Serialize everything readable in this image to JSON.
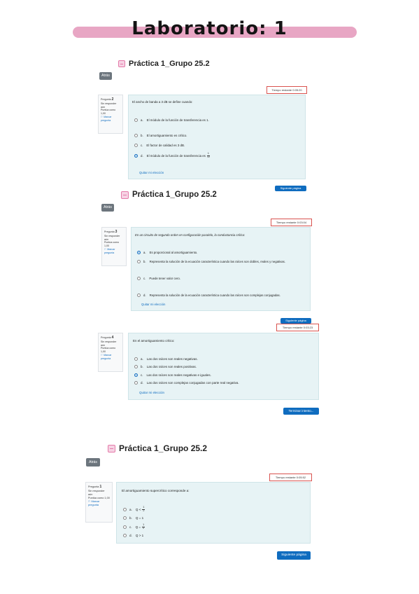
{
  "page": {
    "title": "Laboratorio: 1"
  },
  "sections": [
    {
      "title": "Práctica 1_Grupo 25.2",
      "back_label": "Atrás",
      "timer": "Tiempo restante 0:05:20",
      "info": {
        "label": "Pregunta",
        "number": "2",
        "status": "Sin responder aún",
        "score": "Puntúa como 1,00",
        "flag": "Marcar pregunta"
      },
      "question": "El ancho de banda a 3 dB se define cuando:",
      "options": [
        {
          "letter": "a.",
          "text": "El módulo de la función de transferencia es 1.",
          "selected": false
        },
        {
          "letter": "b.",
          "text": "El amortiguamiento es crítico.",
          "selected": false
        },
        {
          "letter": "c.",
          "text": "El factor de calidad es 3 dB.",
          "selected": false
        },
        {
          "letter": "d.",
          "text": "El módulo de la función de transferencia es",
          "frac_num": "1",
          "frac_den": "√2",
          "selected": true
        }
      ],
      "clear_label": "Quitar mi elección",
      "next_label": "Siguiente página"
    },
    {
      "title": "Práctica 1_Grupo 25.2",
      "back_label": "Atrás",
      "timer": "Tiempo restante 0:03:04",
      "info": {
        "label": "Pregunta",
        "number": "3",
        "status": "Sin responder aún",
        "score": "Puntúa como 1,00",
        "flag": "Marcar pregunta"
      },
      "question": "En un circuito de segundo orden en configuración paralelo, la conductancia crítica:",
      "options": [
        {
          "letter": "a.",
          "text": "Es proporcional al amortiguamiento.",
          "selected": true
        },
        {
          "letter": "b.",
          "text": "Representa la solución de la ecuación característica cuando las raíces son dobles, reales y negativas.",
          "selected": false
        },
        {
          "letter": "c.",
          "text": "Puede tener valor cero.",
          "selected": false
        },
        {
          "letter": "d.",
          "text": "Representa la solución de la ecuación característica cuando las raíces son complejas conjugadas.",
          "selected": false
        }
      ],
      "clear_label": "Quitar mi elección",
      "next_label": "Siguiente página"
    },
    {
      "timer": "Tiempo restante 0:03:23",
      "info": {
        "label": "Pregunta",
        "number": "4",
        "status": "Sin responder aún",
        "score": "Puntúa como 1,00",
        "flag": "Marcar pregunta"
      },
      "question": "En el amortiguamiento crítico:",
      "options": [
        {
          "letter": "a.",
          "text": "Las dos raíces son reales negativas.",
          "selected": false
        },
        {
          "letter": "b.",
          "text": "Las dos raíces son reales positivas.",
          "selected": false
        },
        {
          "letter": "c.",
          "text": "Las dos raíces son reales negativas e iguales.",
          "selected": true
        },
        {
          "letter": "d.",
          "text": "Las dos raíces son complejas conjugadas con parte real negativa.",
          "selected": false
        }
      ],
      "clear_label": "Quitar mi elección",
      "finish_label": "Terminar intento..."
    },
    {
      "title": "Práctica 1_Grupo 25.2",
      "back_label": "Atrás",
      "timer": "Tiempo restante 0:05:52",
      "info": {
        "label": "Pregunta",
        "number": "1",
        "status": "Sin responder aún",
        "score": "Puntúa como 1,00",
        "flag": "Marcar pregunta"
      },
      "question": "El amortiguamiento supercrítico corresponde a:",
      "options": [
        {
          "letter": "a.",
          "text": "Q <",
          "frac_num": "1",
          "frac_den": "2",
          "selected": false
        },
        {
          "letter": "b.",
          "text": "Q = 1",
          "selected": false
        },
        {
          "letter": "c.",
          "text": "Q =",
          "frac_num": "1",
          "frac_den": "2",
          "selected": false
        },
        {
          "letter": "d.",
          "text": "Q > 1",
          "selected": false
        }
      ],
      "next_label": "Siguiente página"
    }
  ]
}
